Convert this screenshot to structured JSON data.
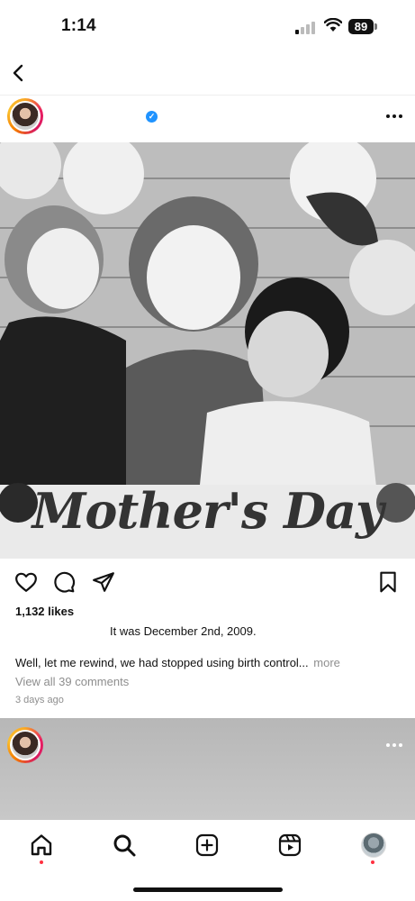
{
  "status_bar": {
    "time": "1:14",
    "battery": "89"
  },
  "post": {
    "likes": "1,132 likes",
    "caption_title": "It was December 2nd, 2009.",
    "caption_body": "Well, let me rewind, we had stopped using birth control...",
    "caption_more": "more",
    "comments_link": "View all 39 comments",
    "time_ago": "3 days ago",
    "image_text": "Mother's Day"
  },
  "icons": {
    "back": "chevron-left-icon",
    "verified": "verified-badge-icon",
    "more": "more-horizontal-icon",
    "like": "heart-icon",
    "comment": "comment-icon",
    "share": "send-icon",
    "save": "bookmark-icon",
    "tabs": [
      "home-icon",
      "search-icon",
      "create-icon",
      "reels-icon",
      "profile-avatar"
    ]
  },
  "colors": {
    "verified": "#1f93ff",
    "notification_dot": "#ff3040",
    "secondary_text": "#8e8e8e"
  }
}
